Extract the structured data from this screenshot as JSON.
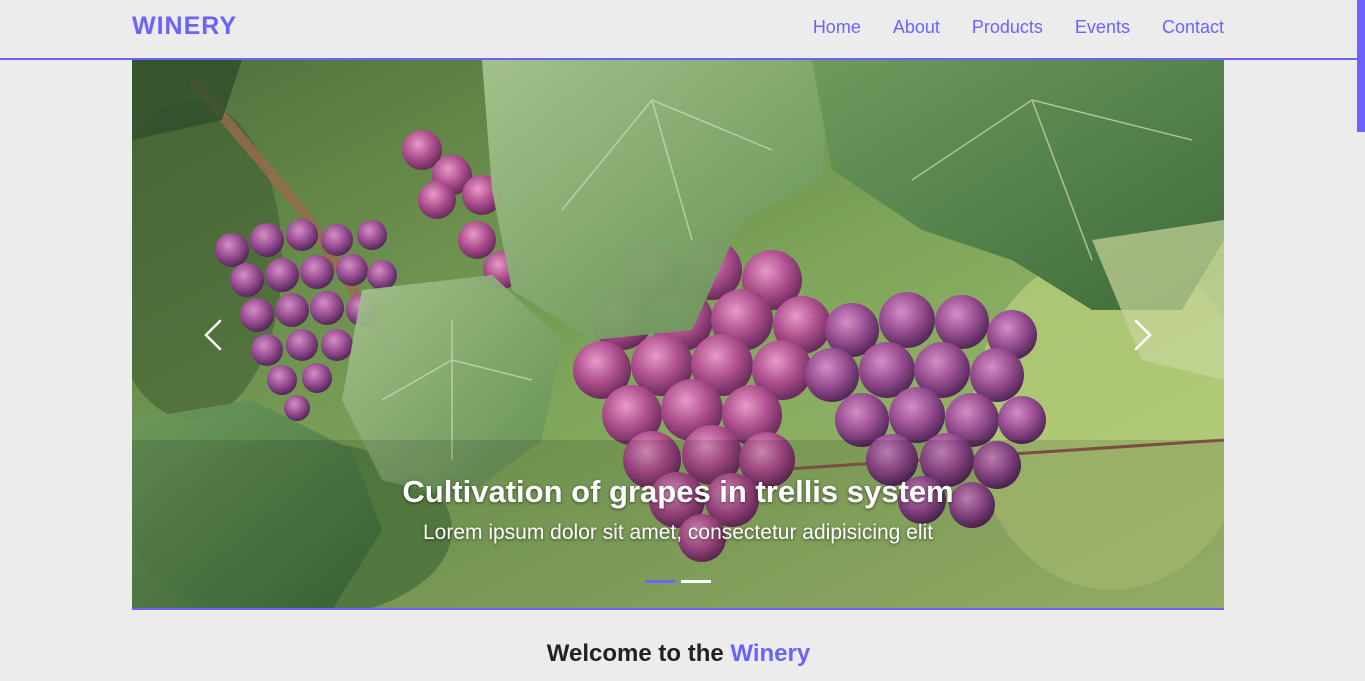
{
  "brand": "WINERY",
  "nav": {
    "items": [
      "Home",
      "About",
      "Products",
      "Events",
      "Contact"
    ]
  },
  "carousel": {
    "title": "Cultivation of grapes in trellis system",
    "subtitle": "Lorem ipsum dolor sit amet, consectetur adipisicing elit",
    "prev_icon": "chevron-left-icon",
    "next_icon": "chevron-right-icon",
    "slide_count": 2,
    "active_slide": 1,
    "image": "grape-vine-photo"
  },
  "welcome": {
    "prefix": "Welcome to the",
    "accent": "Winery"
  },
  "colors": {
    "accent": "#6c63ff",
    "background": "#ececec"
  }
}
